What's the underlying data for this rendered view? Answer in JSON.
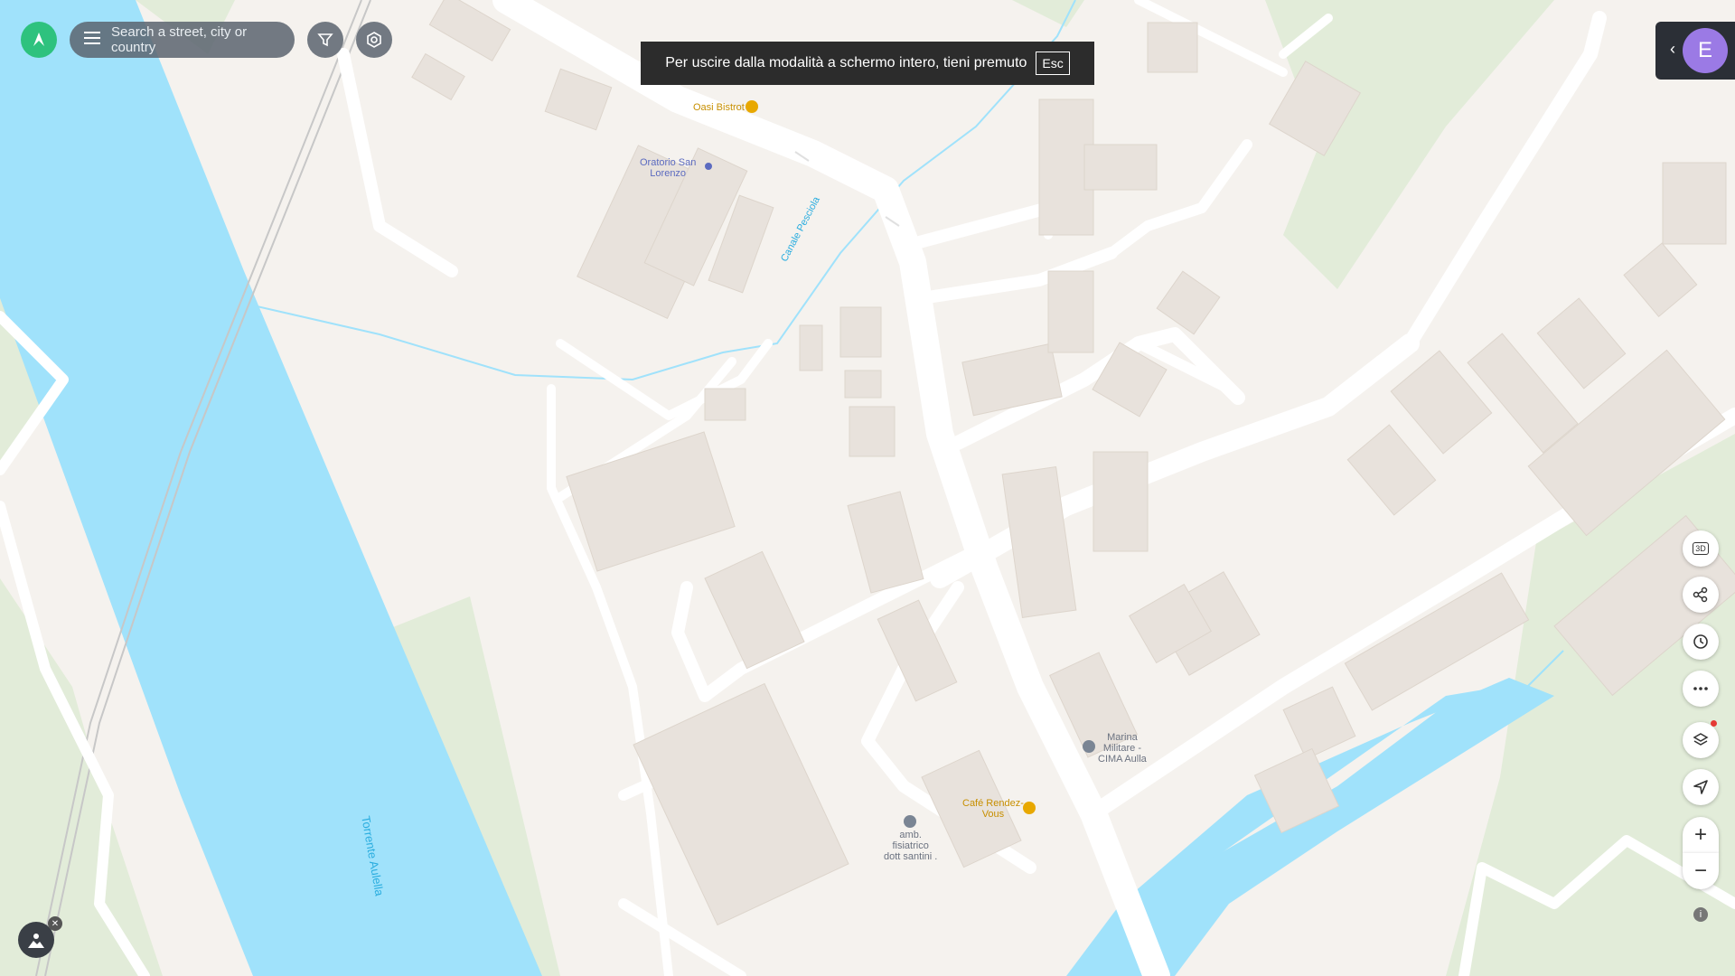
{
  "search": {
    "placeholder": "Search a street, city or country"
  },
  "toast": {
    "message": "Per uscire dalla modalità a schermo intero, tieni premuto",
    "key": "Esc"
  },
  "user": {
    "initial": "E"
  },
  "controls": {
    "three_d_label": "3D",
    "zoom_in": "+",
    "zoom_out": "−",
    "info": "i"
  },
  "colors": {
    "water": "#a0e2fb",
    "land": "#f5f2ee",
    "park": "#e2ecd9",
    "building": "#e8e2dc",
    "road": "#ffffff",
    "poi_food": "#e8a800",
    "poi_blue": "#5c6bc0",
    "accent": "#2ec27e"
  },
  "map_labels": {
    "oasi": "Oasi Bistrot",
    "oratorio_1": "Oratorio San",
    "oratorio_2": "Lorenzo",
    "canale": "Canale Pesciola",
    "torrente": "Torrente Aulella",
    "marina_1": "Marina",
    "marina_2": "Militare -",
    "marina_3": "CIMA Aulla",
    "cafe_1": "Café Rendez-",
    "cafe_2": "Vous",
    "amb_1": "amb.",
    "amb_2": "fisiatrico",
    "amb_3": "dott santini ."
  }
}
